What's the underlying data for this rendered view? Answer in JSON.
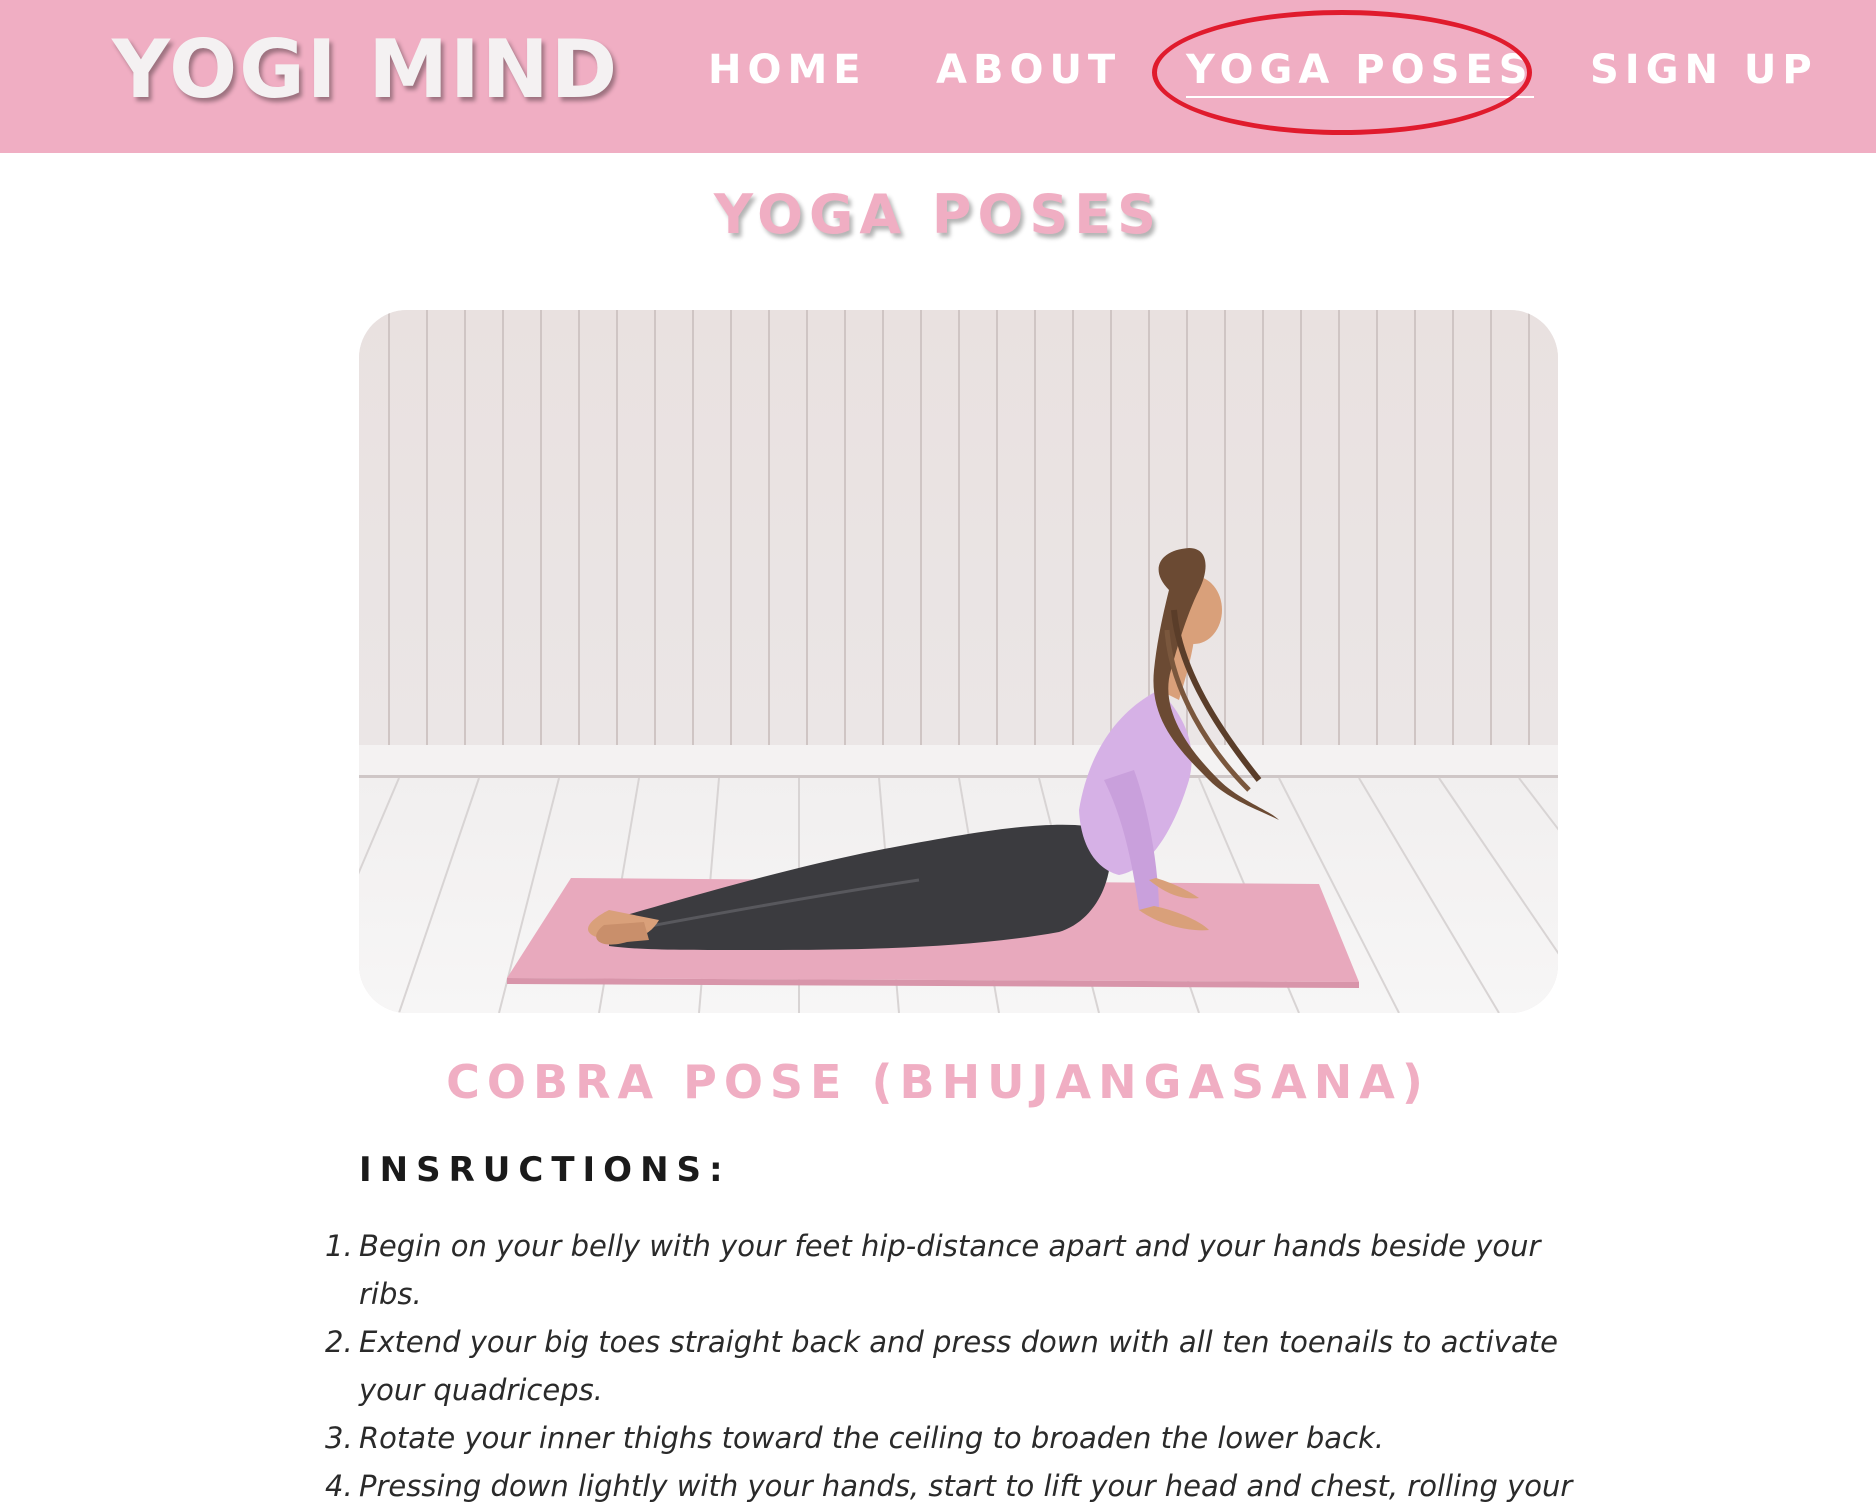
{
  "header": {
    "logo": "YOGI MIND",
    "nav": {
      "home": "HOME",
      "about": "ABOUT",
      "yoga_poses": "YOGA POSES",
      "sign_up": "SIGN UP"
    },
    "active_item": "YOGA POSES"
  },
  "colors": {
    "brand_pink": "#f0aec3",
    "highlight_ring": "#e01b2d"
  },
  "main": {
    "page_title": "YOGA POSES",
    "photo": {
      "icon": "cobra-pose-photo"
    },
    "pose_title": "COBRA POSE (BHUJANGASANA)",
    "instructions_heading": "INSRUCTIONS:",
    "steps": [
      {
        "num": "1.",
        "text": "Begin on your belly with your feet hip-distance apart and your hands beside your ribs."
      },
      {
        "num": "2.",
        "text": "Extend your big toes straight back and press down with all ten toenails to activate your quadriceps."
      },
      {
        "num": "3.",
        "text": "Rotate your inner thighs toward the ceiling to broaden the lower back."
      },
      {
        "num": "4.",
        "text": "Pressing down lightly with your hands, start to lift your head and chest, rolling your"
      }
    ]
  }
}
